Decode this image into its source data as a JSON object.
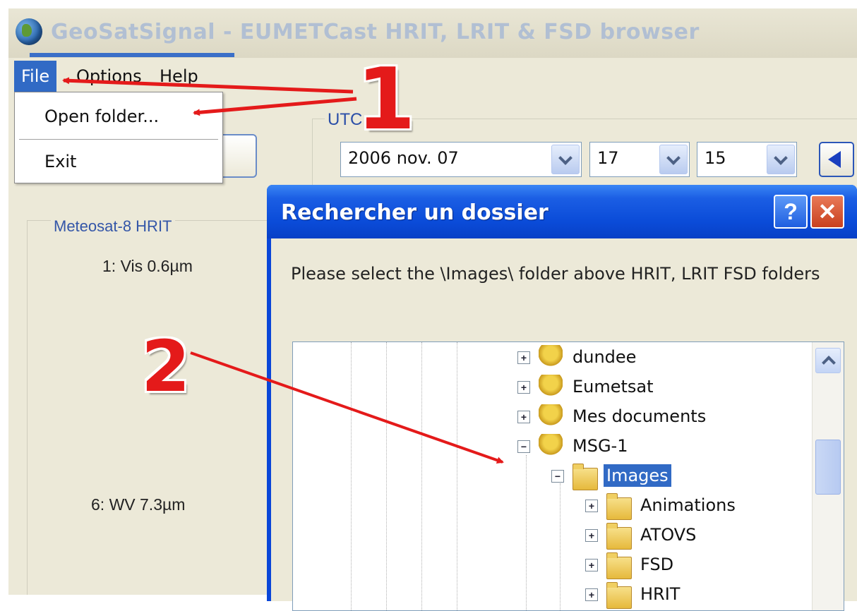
{
  "window": {
    "title": "GeoSatSignal - EUMETCast HRIT, LRIT & FSD browser"
  },
  "menubar": {
    "file": "File",
    "options": "Options",
    "help": "Help"
  },
  "file_menu": {
    "open_folder": "Open folder...",
    "exit": "Exit"
  },
  "utc": {
    "label": "UTC",
    "date": "2006 nov. 07",
    "hour": "17",
    "minute": "15"
  },
  "meteosat": {
    "label": "Meteosat-8 HRIT",
    "channel1": "1: Vis 0.6µm",
    "channel6": "6: WV 7.3µm"
  },
  "dialog": {
    "title": "Rechercher un dossier",
    "help_glyph": "?",
    "close_glyph": "✕",
    "prompt": "Please select the \\Images\\ folder above HRIT, LRIT  FSD folders"
  },
  "tree": [
    {
      "label": "dundee",
      "expander": "+",
      "type": "network-folder"
    },
    {
      "label": "Eumetsat",
      "expander": "+",
      "type": "network-folder"
    },
    {
      "label": "Mes documents",
      "expander": "+",
      "type": "network-folder"
    },
    {
      "label": "MSG-1",
      "expander": "−",
      "type": "network-folder"
    },
    {
      "label": "Images",
      "expander": "−",
      "type": "open-folder",
      "selected": true
    },
    {
      "label": "Animations",
      "expander": "+",
      "type": "folder"
    },
    {
      "label": "ATOVS",
      "expander": "+",
      "type": "folder"
    },
    {
      "label": "FSD",
      "expander": "+",
      "type": "folder"
    },
    {
      "label": "HRIT",
      "expander": "+",
      "type": "folder"
    }
  ],
  "annotations": {
    "step1": "1",
    "step2": "2"
  },
  "colors": {
    "menu_highlight": "#316ac5",
    "dialog_title": "#0a46d8",
    "annotation": "#e41a1a"
  }
}
